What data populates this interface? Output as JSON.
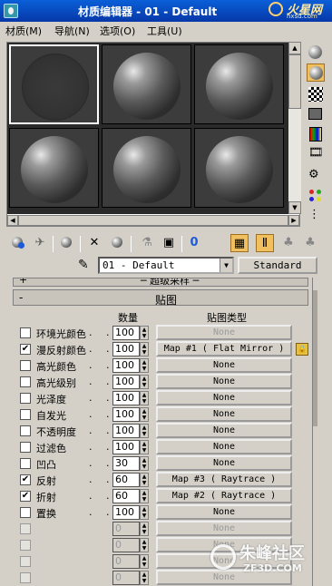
{
  "window": {
    "title": "材质编辑器 - 01 - Default",
    "brand": "火星网",
    "brand_url": "hxsd.com"
  },
  "menu": [
    {
      "label": "材质(M)"
    },
    {
      "label": "导航(N)"
    },
    {
      "label": "选项(O)"
    },
    {
      "label": "工具(U)"
    }
  ],
  "material": {
    "name": "01 - Default",
    "type": "Standard"
  },
  "rollouts": {
    "previous": "─ 超级采样 ─",
    "maps": {
      "toggle": "-",
      "title": "贴图"
    }
  },
  "maps_table": {
    "col_amount": "数量",
    "col_type": "贴图类型",
    "rows": [
      {
        "checked": false,
        "label": "环境光颜色",
        "amount": "100",
        "map": "None",
        "disabled_map": true
      },
      {
        "checked": true,
        "label": "漫反射颜色",
        "amount": "100",
        "map": "Map #1  ( Flat Mirror )"
      },
      {
        "checked": false,
        "label": "高光颜色",
        "amount": "100",
        "map": "None"
      },
      {
        "checked": false,
        "label": "高光级别",
        "amount": "100",
        "map": "None"
      },
      {
        "checked": false,
        "label": "光泽度",
        "amount": "100",
        "map": "None"
      },
      {
        "checked": false,
        "label": "自发光",
        "amount": "100",
        "map": "None"
      },
      {
        "checked": false,
        "label": "不透明度",
        "amount": "100",
        "map": "None"
      },
      {
        "checked": false,
        "label": "过滤色",
        "amount": "100",
        "map": "None"
      },
      {
        "checked": false,
        "label": "凹凸",
        "amount": "30",
        "map": "None"
      },
      {
        "checked": true,
        "label": "反射",
        "amount": "60",
        "map": "Map #3  ( Raytrace )"
      },
      {
        "checked": true,
        "label": "折射",
        "amount": "60",
        "map": "Map #2  ( Raytrace )"
      },
      {
        "checked": false,
        "label": "置换",
        "amount": "100",
        "map": "None"
      },
      {
        "checked": false,
        "label": "",
        "amount": "0",
        "map": "None",
        "disabled": true
      },
      {
        "checked": false,
        "label": "",
        "amount": "0",
        "map": "None",
        "disabled": true
      },
      {
        "checked": false,
        "label": "",
        "amount": "0",
        "map": "None",
        "disabled": true
      },
      {
        "checked": false,
        "label": "",
        "amount": "0",
        "map": "None",
        "disabled": true
      }
    ]
  },
  "watermark": {
    "text": "朱峰社区",
    "url": "ZF3D.COM"
  },
  "colors": {
    "title_blue": "#0a5fd8",
    "panel_gray": "#d4d0c8",
    "active_yellow": "#f0c060"
  }
}
